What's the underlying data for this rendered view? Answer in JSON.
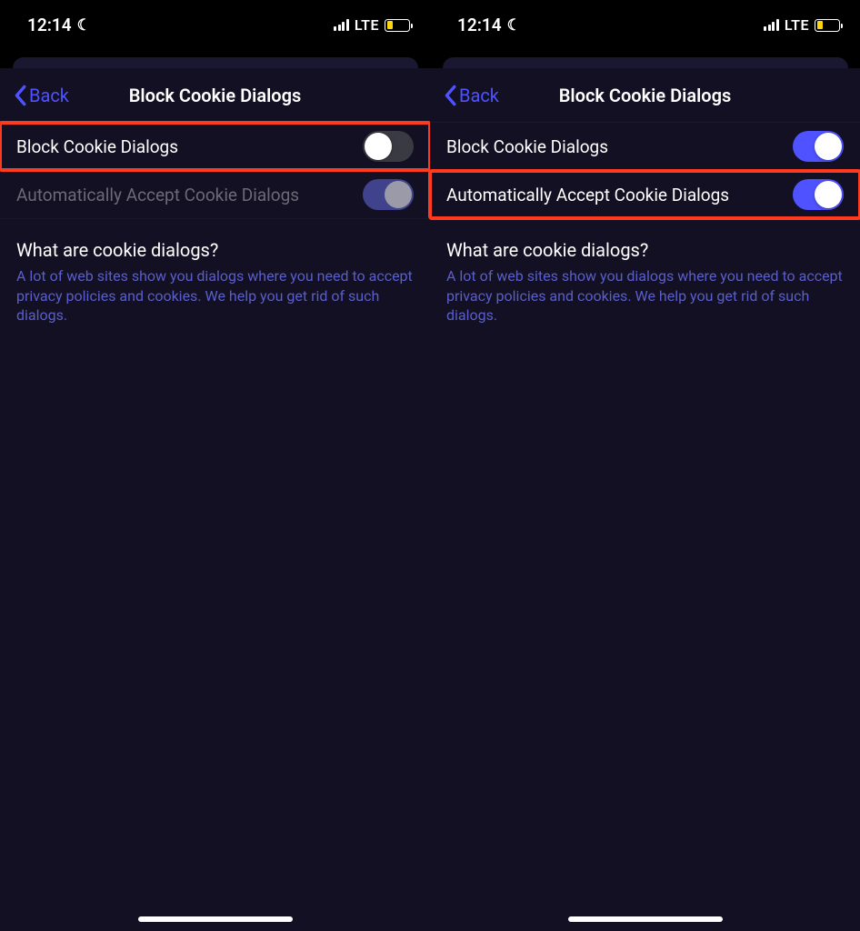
{
  "status": {
    "time": "12:14",
    "network": "LTE"
  },
  "nav": {
    "back_label": "Back",
    "title": "Block Cookie Dialogs"
  },
  "rows": {
    "block_label": "Block Cookie Dialogs",
    "auto_label": "Automatically Accept Cookie Dialogs"
  },
  "info": {
    "heading": "What are cookie dialogs?",
    "body": "A lot of web sites show you dialogs where you need to accept privacy policies and cookies. We help you get rid of such dialogs."
  },
  "screens": {
    "left": {
      "block_toggle": "off",
      "auto_toggle": "on-disabled",
      "auto_disabled": true,
      "highlighted_row": "block"
    },
    "right": {
      "block_toggle": "on",
      "auto_toggle": "on",
      "auto_disabled": false,
      "highlighted_row": "auto"
    }
  }
}
